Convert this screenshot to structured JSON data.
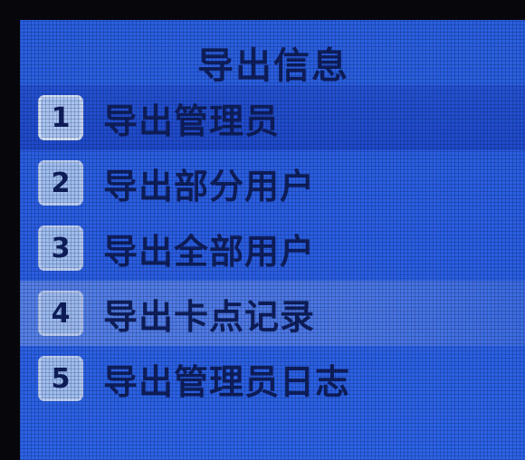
{
  "screen": {
    "title": "导出信息"
  },
  "menu": {
    "items": [
      {
        "number": "1",
        "label": "导出管理员"
      },
      {
        "number": "2",
        "label": "导出部分用户"
      },
      {
        "number": "3",
        "label": "导出全部用户"
      },
      {
        "number": "4",
        "label": "导出卡点记录"
      },
      {
        "number": "5",
        "label": "导出管理员日志"
      }
    ],
    "selected_index": 0,
    "highlighted_index": 3
  },
  "colors": {
    "screen_background": "#2a5fe0",
    "text": "#0f1f5c",
    "badge": "#9ebdf0"
  }
}
